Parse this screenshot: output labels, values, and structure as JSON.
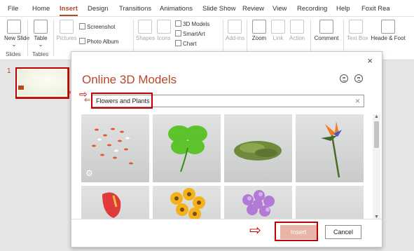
{
  "tabs": [
    "File",
    "Home",
    "Insert",
    "Design",
    "Transitions",
    "Animations",
    "Slide Show",
    "Review",
    "View",
    "Recording",
    "Help",
    "Foxit Rea"
  ],
  "active_tab": "Insert",
  "ribbon": {
    "new_slide": "New Slide",
    "new_slide_caret": "⌄",
    "slides_group": "Slides",
    "table": "Table",
    "table_caret": "⌄",
    "tables_group": "Tables",
    "pictures": "Pictures",
    "screenshot": "Screenshot",
    "photo_album": "Photo Album",
    "shapes": "Shapes",
    "icons": "Icons",
    "models_3d": "3D Models",
    "smartart": "SmartArt",
    "chart": "Chart",
    "addins": "Add-ins",
    "zoom": "Zoom",
    "link": "Link",
    "action": "Action",
    "comment": "Comment",
    "textbox": "Text Box",
    "header_footer": "Heade & Foot"
  },
  "slides_pane": {
    "slide_number": "1"
  },
  "dialog": {
    "title": "Online 3D Models",
    "close": "×",
    "search_value": "Flowers and Plants",
    "search_clear": "×",
    "back": "⇐",
    "tiles": [
      "Petals",
      "Clover",
      "Moss",
      "Bird of Paradise",
      "Anthurium",
      "Sunflowers",
      "Lilac flowers",
      "Empty"
    ],
    "insert": "Insert",
    "cancel": "Cancel"
  },
  "colors": {
    "accent": "#b7472a",
    "highlight": "#c00000"
  }
}
